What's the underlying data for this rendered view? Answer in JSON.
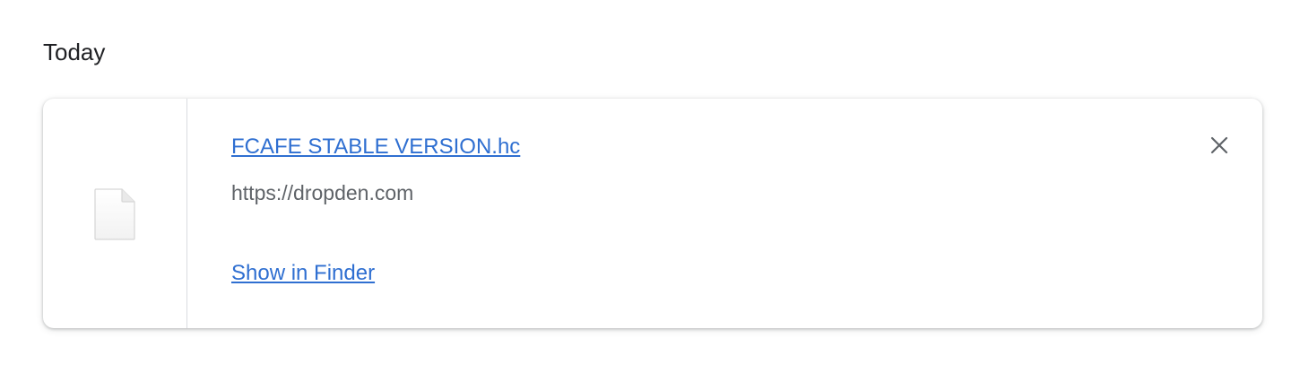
{
  "section": {
    "heading": "Today"
  },
  "download": {
    "file_name": "FCAFE STABLE VERSION.hc",
    "source_url": "https://dropden.com",
    "action_label": "Show in Finder",
    "file_icon": "file-icon",
    "remove_icon": "close-icon"
  },
  "colors": {
    "link": "#2f6fd1",
    "url_text": "#5f6368",
    "heading_text": "#202124",
    "divider": "#dadce0"
  }
}
